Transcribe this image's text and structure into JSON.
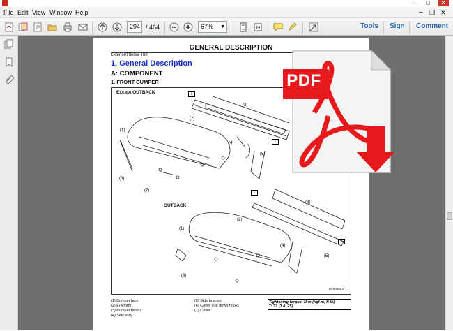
{
  "window": {
    "min": "–",
    "max": "□",
    "close": "✕"
  },
  "menu": [
    "File",
    "Edit",
    "View",
    "Window",
    "Help"
  ],
  "toolbar": {
    "page_current": "294",
    "page_total": "/ 464",
    "zoom": "67%",
    "tools": "Tools",
    "sign": "Sign",
    "comment": "Comment"
  },
  "document": {
    "header_title": "GENERAL DESCRIPTION",
    "section": "Exterior/Interior Trim",
    "heading1": "1.  General Description",
    "heading2": "A:  COMPONENT",
    "heading3": "1.  FRONT BUMPER",
    "label_except": "Except OUTBACK",
    "label_outback": "OUTBACK",
    "callout_t": "T",
    "figure_code": "EI-00488A",
    "legend_left": [
      "(1)   Bumper face",
      "(2)   E/A form",
      "(3)   Bumper beam",
      "(4)   Side stay"
    ],
    "legend_right": [
      "(5)   Side bracket",
      "(6)   Cover (Tie down hook)",
      "(7)   Cover"
    ],
    "torque_title": "Tightening torque: N·m (kgf-m, ft-lb)",
    "torque_value": "T:  33 (3.4, 25)"
  },
  "callouts_top": [
    "(1)",
    "(2)",
    "(3)",
    "(4)",
    "(5)",
    "(6)",
    "(7)"
  ],
  "callouts_bottom": [
    "(1)",
    "(2)",
    "(3)",
    "(4)",
    "(5)",
    "(6)"
  ],
  "overlay": {
    "badge": "PDF"
  },
  "colors": {
    "accent_red": "#e8191c",
    "link_blue": "#2d64b0",
    "heading_blue": "#1a35c9"
  }
}
